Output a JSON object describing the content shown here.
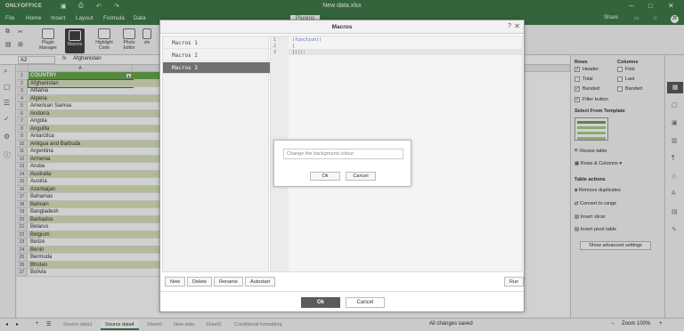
{
  "app": {
    "logo": "ONLYOFFICE",
    "document_title": "New data.xlsx"
  },
  "menu": {
    "items": [
      "File",
      "Home",
      "Insert",
      "Layout",
      "Formula",
      "Data"
    ],
    "active": "Plugins",
    "share": "Share",
    "avatar_initials": "JF"
  },
  "toolbar": {
    "plugin_manager": "Plugin Manager",
    "macros": "Macros",
    "highlight_code": "Highlight Code",
    "photo_editor": "Photo Editor",
    "zotero": "zte"
  },
  "formula_bar": {
    "cell_ref": "A2",
    "fx": "fx",
    "value": "Afghanistan"
  },
  "sheet": {
    "col_a": "A",
    "header": "COUNTRY",
    "rows": [
      "Afghanistan",
      "Albania",
      "Algeria",
      "American Samoa",
      "Andorra",
      "Angola",
      "Anguilla",
      "Antarctica",
      "Antigua and Barbuda",
      "Argentina",
      "Armenia",
      "Aruba",
      "Australia",
      "Austria",
      "Azerbaijan",
      "Bahamas",
      "Bahrain",
      "Bangladesh",
      "Barbados",
      "Belarus",
      "Belgium",
      "Belize",
      "Benin",
      "Bermuda",
      "Bhutan",
      "Bolivia"
    ],
    "row_numbers": [
      "1",
      "2",
      "3",
      "4",
      "5",
      "6",
      "7",
      "8",
      "9",
      "10",
      "11",
      "12",
      "13",
      "14",
      "15",
      "16",
      "17",
      "18",
      "19",
      "20",
      "21",
      "22",
      "23",
      "24",
      "25",
      "26",
      "27"
    ]
  },
  "right_panel": {
    "rows_title": "Rows",
    "columns_title": "Columns",
    "header": "Header",
    "total": "Total",
    "banded_rows": "Banded",
    "first": "First",
    "last": "Last",
    "banded_cols": "Banded",
    "filter_button": "Filter button",
    "select_template": "Select From Template",
    "resize_table": "Resize table",
    "rows_columns": "Rows & Columns",
    "table_actions": "Table actions",
    "remove_duplicates": "Remove duplicates",
    "convert_to_range": "Convert to range",
    "insert_slicer": "Insert slicer",
    "insert_pivot": "Insert pivot table",
    "show_advanced": "Show advanced settings"
  },
  "statusbar": {
    "tabs": [
      "Source data1",
      "Source data4",
      "Sheet1",
      "New data",
      "Sheet2",
      "Conditional formatting"
    ],
    "active_tab": "Source data4",
    "save_status": "All changes saved",
    "zoom": "Zoom 100%"
  },
  "dialog": {
    "title": "Macros",
    "help": "?",
    "macros": [
      "Macros 1",
      "Macros 2",
      "Macros 3"
    ],
    "selected": "Macros 3",
    "code_lines": [
      "(function()",
      "{",
      "})();"
    ],
    "line_numbers": [
      "1",
      "2",
      "3"
    ],
    "buttons": {
      "new": "New",
      "delete": "Delete",
      "rename": "Rename",
      "autostart": "Autostart",
      "run": "Run"
    },
    "ok": "Ok",
    "cancel": "Cancel"
  },
  "prompt": {
    "placeholder": "Change the background colour",
    "ok": "Ok",
    "cancel": "Cancel"
  },
  "colors": {
    "brand": "#3f7a4a",
    "header_green": "#6aa84f",
    "band": "#d8e4bc"
  }
}
